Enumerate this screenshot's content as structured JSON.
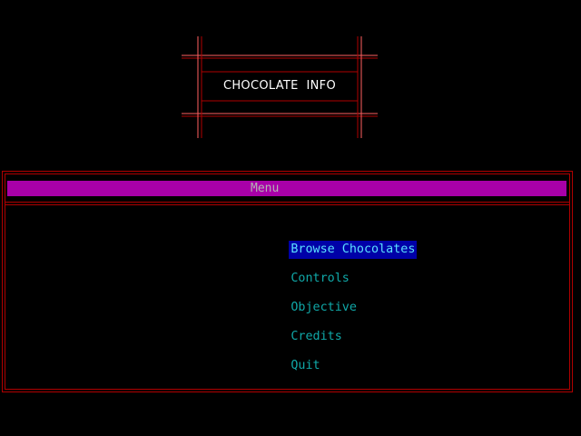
{
  "title": {
    "text": "CHOCOLATE  INFO"
  },
  "menu": {
    "header": "Menu",
    "items": [
      {
        "label": "Browse Chocolates",
        "selected": true
      },
      {
        "label": "Controls",
        "selected": false
      },
      {
        "label": "Objective",
        "selected": false
      },
      {
        "label": "Credits",
        "selected": false
      },
      {
        "label": "Quit",
        "selected": false
      }
    ]
  },
  "colors": {
    "background": "#000000",
    "frame_red": "#b00000",
    "frame_pink": "#ff6060",
    "header_bar": "#a800a8",
    "menu_text": "#10a8a8",
    "selected_bg": "#0000a8",
    "selected_text": "#5ce1ff"
  }
}
